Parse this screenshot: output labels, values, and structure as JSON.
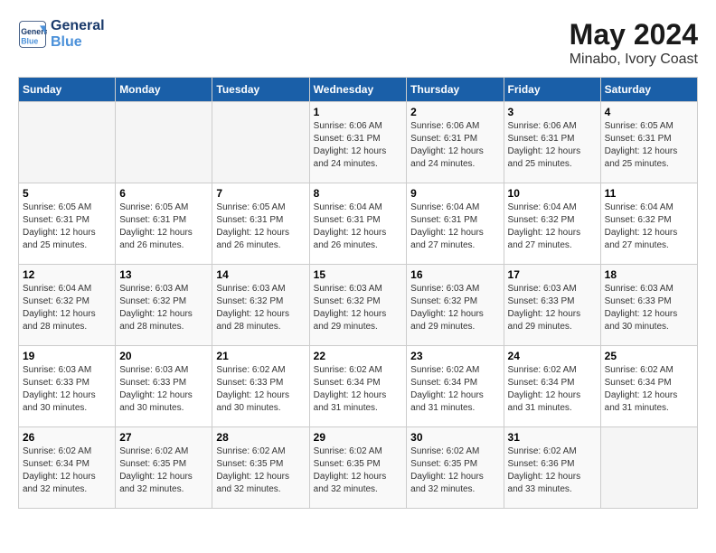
{
  "header": {
    "logo_line1": "General",
    "logo_line2": "Blue",
    "month": "May 2024",
    "location": "Minabo, Ivory Coast"
  },
  "days_of_week": [
    "Sunday",
    "Monday",
    "Tuesday",
    "Wednesday",
    "Thursday",
    "Friday",
    "Saturday"
  ],
  "weeks": [
    [
      {
        "day": "",
        "info": ""
      },
      {
        "day": "",
        "info": ""
      },
      {
        "day": "",
        "info": ""
      },
      {
        "day": "1",
        "info": "Sunrise: 6:06 AM\nSunset: 6:31 PM\nDaylight: 12 hours\nand 24 minutes."
      },
      {
        "day": "2",
        "info": "Sunrise: 6:06 AM\nSunset: 6:31 PM\nDaylight: 12 hours\nand 24 minutes."
      },
      {
        "day": "3",
        "info": "Sunrise: 6:06 AM\nSunset: 6:31 PM\nDaylight: 12 hours\nand 25 minutes."
      },
      {
        "day": "4",
        "info": "Sunrise: 6:05 AM\nSunset: 6:31 PM\nDaylight: 12 hours\nand 25 minutes."
      }
    ],
    [
      {
        "day": "5",
        "info": "Sunrise: 6:05 AM\nSunset: 6:31 PM\nDaylight: 12 hours\nand 25 minutes."
      },
      {
        "day": "6",
        "info": "Sunrise: 6:05 AM\nSunset: 6:31 PM\nDaylight: 12 hours\nand 26 minutes."
      },
      {
        "day": "7",
        "info": "Sunrise: 6:05 AM\nSunset: 6:31 PM\nDaylight: 12 hours\nand 26 minutes."
      },
      {
        "day": "8",
        "info": "Sunrise: 6:04 AM\nSunset: 6:31 PM\nDaylight: 12 hours\nand 26 minutes."
      },
      {
        "day": "9",
        "info": "Sunrise: 6:04 AM\nSunset: 6:31 PM\nDaylight: 12 hours\nand 27 minutes."
      },
      {
        "day": "10",
        "info": "Sunrise: 6:04 AM\nSunset: 6:32 PM\nDaylight: 12 hours\nand 27 minutes."
      },
      {
        "day": "11",
        "info": "Sunrise: 6:04 AM\nSunset: 6:32 PM\nDaylight: 12 hours\nand 27 minutes."
      }
    ],
    [
      {
        "day": "12",
        "info": "Sunrise: 6:04 AM\nSunset: 6:32 PM\nDaylight: 12 hours\nand 28 minutes."
      },
      {
        "day": "13",
        "info": "Sunrise: 6:03 AM\nSunset: 6:32 PM\nDaylight: 12 hours\nand 28 minutes."
      },
      {
        "day": "14",
        "info": "Sunrise: 6:03 AM\nSunset: 6:32 PM\nDaylight: 12 hours\nand 28 minutes."
      },
      {
        "day": "15",
        "info": "Sunrise: 6:03 AM\nSunset: 6:32 PM\nDaylight: 12 hours\nand 29 minutes."
      },
      {
        "day": "16",
        "info": "Sunrise: 6:03 AM\nSunset: 6:32 PM\nDaylight: 12 hours\nand 29 minutes."
      },
      {
        "day": "17",
        "info": "Sunrise: 6:03 AM\nSunset: 6:33 PM\nDaylight: 12 hours\nand 29 minutes."
      },
      {
        "day": "18",
        "info": "Sunrise: 6:03 AM\nSunset: 6:33 PM\nDaylight: 12 hours\nand 30 minutes."
      }
    ],
    [
      {
        "day": "19",
        "info": "Sunrise: 6:03 AM\nSunset: 6:33 PM\nDaylight: 12 hours\nand 30 minutes."
      },
      {
        "day": "20",
        "info": "Sunrise: 6:03 AM\nSunset: 6:33 PM\nDaylight: 12 hours\nand 30 minutes."
      },
      {
        "day": "21",
        "info": "Sunrise: 6:02 AM\nSunset: 6:33 PM\nDaylight: 12 hours\nand 30 minutes."
      },
      {
        "day": "22",
        "info": "Sunrise: 6:02 AM\nSunset: 6:34 PM\nDaylight: 12 hours\nand 31 minutes."
      },
      {
        "day": "23",
        "info": "Sunrise: 6:02 AM\nSunset: 6:34 PM\nDaylight: 12 hours\nand 31 minutes."
      },
      {
        "day": "24",
        "info": "Sunrise: 6:02 AM\nSunset: 6:34 PM\nDaylight: 12 hours\nand 31 minutes."
      },
      {
        "day": "25",
        "info": "Sunrise: 6:02 AM\nSunset: 6:34 PM\nDaylight: 12 hours\nand 31 minutes."
      }
    ],
    [
      {
        "day": "26",
        "info": "Sunrise: 6:02 AM\nSunset: 6:34 PM\nDaylight: 12 hours\nand 32 minutes."
      },
      {
        "day": "27",
        "info": "Sunrise: 6:02 AM\nSunset: 6:35 PM\nDaylight: 12 hours\nand 32 minutes."
      },
      {
        "day": "28",
        "info": "Sunrise: 6:02 AM\nSunset: 6:35 PM\nDaylight: 12 hours\nand 32 minutes."
      },
      {
        "day": "29",
        "info": "Sunrise: 6:02 AM\nSunset: 6:35 PM\nDaylight: 12 hours\nand 32 minutes."
      },
      {
        "day": "30",
        "info": "Sunrise: 6:02 AM\nSunset: 6:35 PM\nDaylight: 12 hours\nand 32 minutes."
      },
      {
        "day": "31",
        "info": "Sunrise: 6:02 AM\nSunset: 6:36 PM\nDaylight: 12 hours\nand 33 minutes."
      },
      {
        "day": "",
        "info": ""
      }
    ]
  ]
}
